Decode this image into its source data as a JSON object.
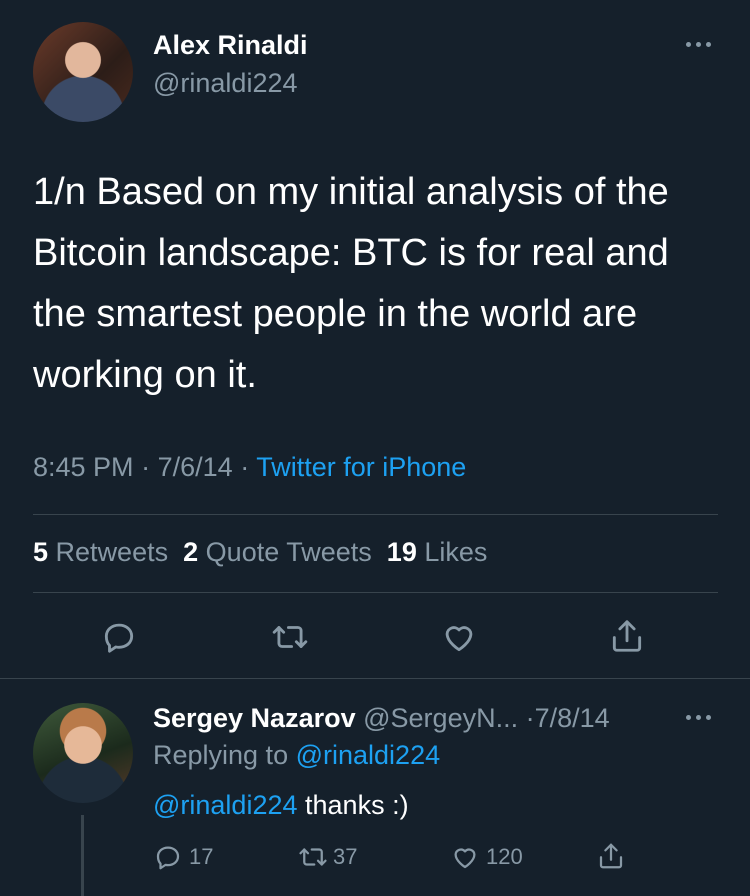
{
  "tweet": {
    "author_name": "Alex Rinaldi",
    "author_handle": "@rinaldi224",
    "text": "1/n Based on my initial analysis of the Bitcoin landscape: BTC is for real and the smartest people in the world are working on it.",
    "time": "8:45 PM",
    "date": "7/6/14",
    "separator": "·",
    "source": "Twitter for iPhone",
    "stats": {
      "retweets_count": "5",
      "retweets_label": "Retweets",
      "quotes_count": "2",
      "quotes_label": "Quote Tweets",
      "likes_count": "19",
      "likes_label": "Likes"
    }
  },
  "reply": {
    "author_name": "Sergey Nazarov",
    "author_handle": "@SergeyN...",
    "date_sep": "·",
    "date": "7/8/14",
    "replying_to_prefix": "Replying to",
    "replying_to_handle": "@rinaldi224",
    "mention": "@rinaldi224",
    "text": "thanks :)",
    "reply_count": "17",
    "retweet_count": "37",
    "like_count": "120"
  },
  "icons": {
    "more": "more-icon",
    "reply": "reply-icon",
    "retweet": "retweet-icon",
    "like": "heart-icon",
    "share": "share-icon"
  },
  "colors": {
    "background": "#15202b",
    "text": "#ffffff",
    "muted": "#8899a6",
    "link": "#1da1f2",
    "divider": "#38444d"
  }
}
